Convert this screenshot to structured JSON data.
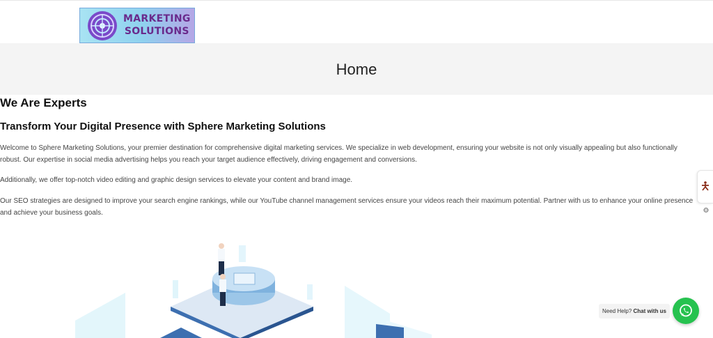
{
  "brand": {
    "line1": "MARKETING",
    "line2": "SOLUTIONS"
  },
  "hero": {
    "title": "Home"
  },
  "content": {
    "heading": "We Are Experts",
    "subheading": "Transform Your Digital Presence with Sphere Marketing Solutions",
    "paragraphs": [
      "Welcome to Sphere Marketing Solutions, your premier destination for comprehensive digital marketing services. We specialize in web development, ensuring your website is not only visually appealing but also functionally robust. Our expertise in social media advertising helps you reach your target audience effectively, driving engagement and conversions.",
      "Additionally, we offer top-notch video editing and graphic design services to elevate your content and brand image.",
      "Our SEO strategies are designed to improve your search engine rankings, while our YouTube channel management services ensure your videos reach their maximum potential. Partner with us to enhance your online presence and achieve your business goals."
    ]
  },
  "chat": {
    "prefix": "Need Help?",
    "action": "Chat with us",
    "icon": "whatsapp-icon"
  },
  "side": {
    "icon": "accessibility-icon",
    "settings_icon": "gear-icon"
  },
  "colors": {
    "hero_bg": "#f4f4f4",
    "whatsapp": "#26c24f",
    "logo_text": "#6a2a8c"
  }
}
